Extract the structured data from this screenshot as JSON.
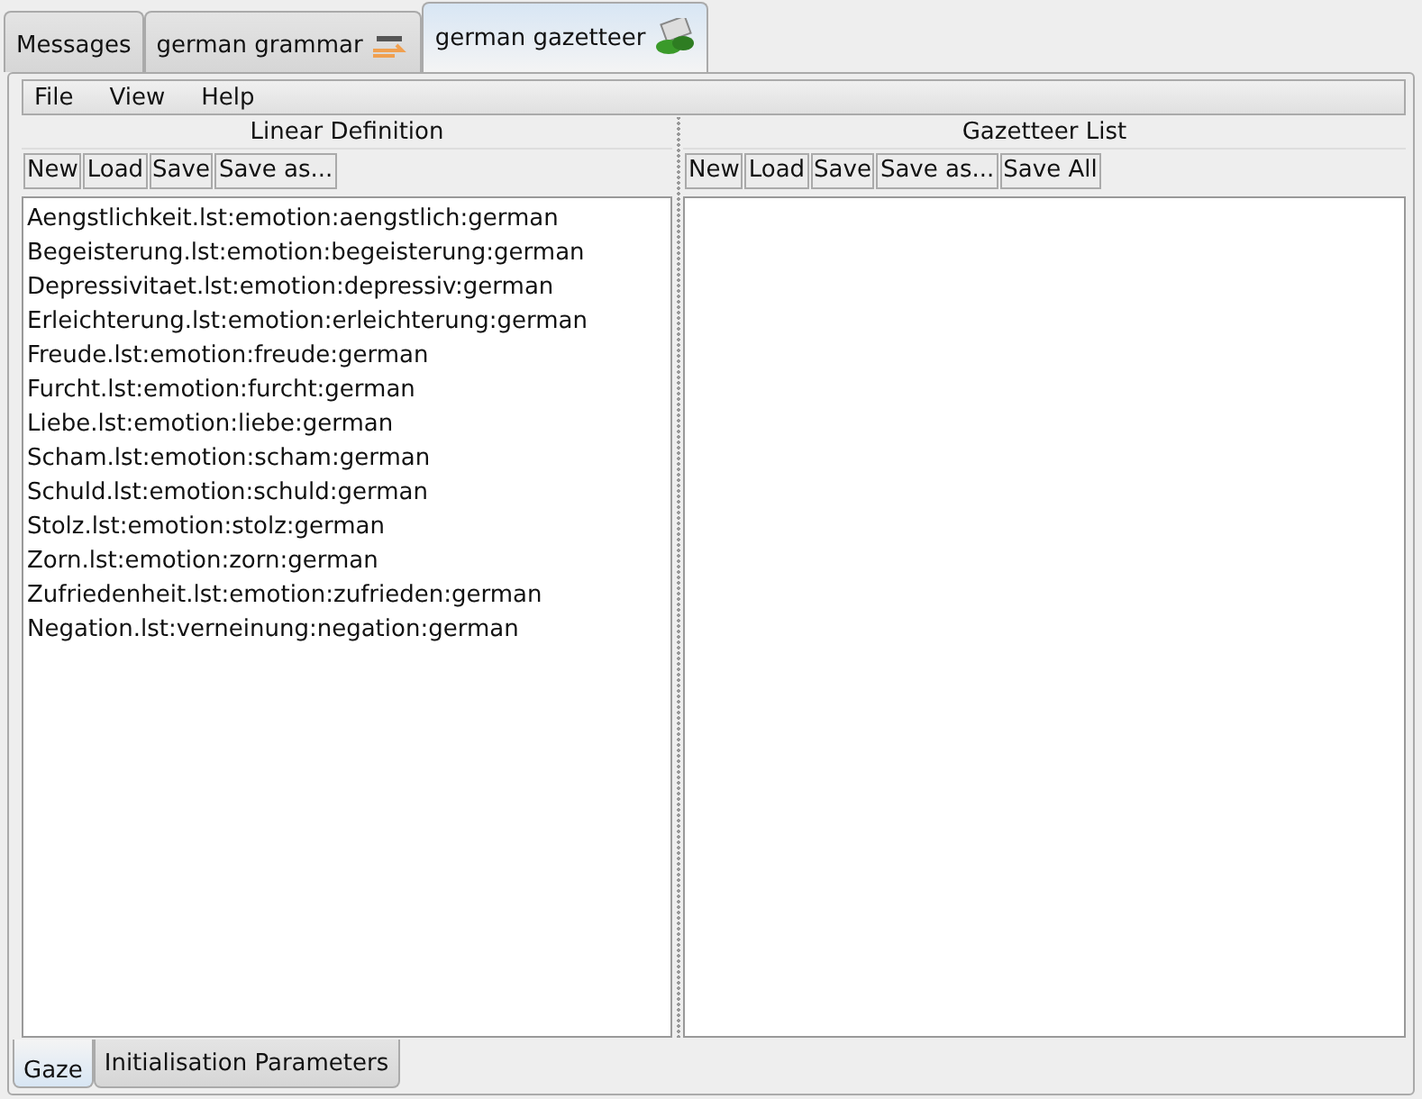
{
  "tabs": [
    {
      "label": "Messages",
      "selected": false,
      "kind": "plain"
    },
    {
      "label": "german grammar",
      "selected": false,
      "kind": "grammar"
    },
    {
      "label": "german gazetteer",
      "selected": true,
      "kind": "gazetteer"
    }
  ],
  "menu": [
    "File",
    "View",
    "Help"
  ],
  "linear_definition": {
    "title": "Linear Definition",
    "buttons": [
      "New",
      "Load",
      "Save",
      "Save as..."
    ],
    "items": [
      "Aengstlichkeit.lst:emotion:aengstlich:german",
      "Begeisterung.lst:emotion:begeisterung:german",
      "Depressivitaet.lst:emotion:depressiv:german",
      "Erleichterung.lst:emotion:erleichterung:german",
      "Freude.lst:emotion:freude:german",
      "Furcht.lst:emotion:furcht:german",
      "Liebe.lst:emotion:liebe:german",
      "Scham.lst:emotion:scham:german",
      "Schuld.lst:emotion:schuld:german",
      "Stolz.lst:emotion:stolz:german",
      "Zorn.lst:emotion:zorn:german",
      "Zufriedenheit.lst:emotion:zufrieden:german",
      "Negation.lst:verneinung:negation:german"
    ]
  },
  "gazetteer_list": {
    "title": "Gazetteer List",
    "buttons": [
      "New",
      "Load",
      "Save",
      "Save as...",
      "Save All"
    ]
  },
  "bottom_tabs": [
    {
      "label": "Gaze",
      "selected": true
    },
    {
      "label": "Initialisation Parameters",
      "selected": false
    }
  ]
}
